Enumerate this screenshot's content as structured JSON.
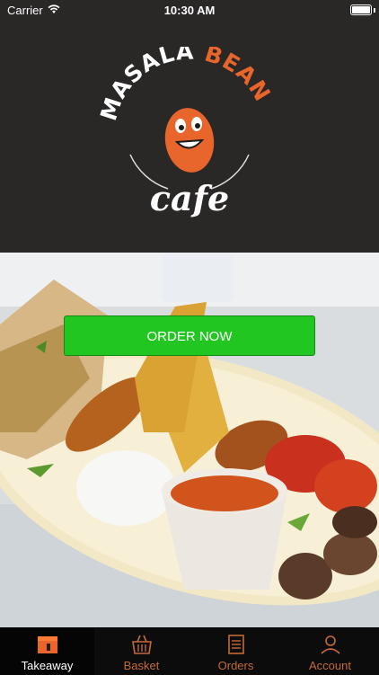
{
  "status": {
    "carrier": "Carrier",
    "time": "10:30 AM"
  },
  "brand": {
    "name_part1": "MASALA",
    "name_part2": "BEAN",
    "subtitle": "cafe",
    "accent_color": "#e8652b"
  },
  "main": {
    "order_button_label": "ORDER NOW",
    "order_button_color": "#22c621"
  },
  "tabs": [
    {
      "label": "Takeaway",
      "icon": "takeaway-icon",
      "active": true
    },
    {
      "label": "Basket",
      "icon": "basket-icon",
      "active": false
    },
    {
      "label": "Orders",
      "icon": "orders-icon",
      "active": false
    },
    {
      "label": "Account",
      "icon": "account-icon",
      "active": false
    }
  ]
}
